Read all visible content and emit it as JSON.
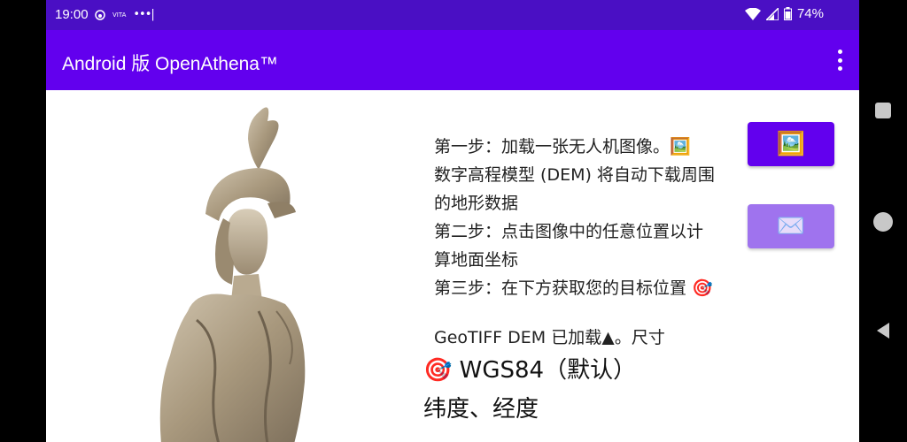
{
  "status_bar": {
    "time": "19:00",
    "notif_icons": "● VITA •••|",
    "battery": "74%"
  },
  "app_bar": {
    "title": "Android 版 OpenAthena™"
  },
  "instructions": {
    "step1": "第一步：加载一张无人机图像。🖼️",
    "dem_note_line1": "数字高程模型 (DEM) 将自动下载周围",
    "dem_note_line2": "的地形数据",
    "step2_line1": "第二步：点击图像中的任意位置以计",
    "step2_line2": "算地面坐标",
    "step3": "第三步：在下方获取您的目标位置 🎯",
    "geotiff_status": "GeoTIFF DEM 已加载▲。尺寸"
  },
  "coordinates": {
    "system": "🎯 WGS84（默认）",
    "label": "纬度、经度"
  },
  "buttons": {
    "load_image_icon": "🖼️",
    "send_icon": "✉️"
  },
  "icons": {
    "signal": "signal-icon",
    "wifi": "wifi-icon",
    "battery": "battery-icon",
    "overflow": "more-vert-icon",
    "statue": "athena-statue-image"
  },
  "colors": {
    "status_bar": "#4a0fc4",
    "app_bar": "#6200ee",
    "primary_button": "#6200ee",
    "disabled_button": "#9f73ee"
  }
}
